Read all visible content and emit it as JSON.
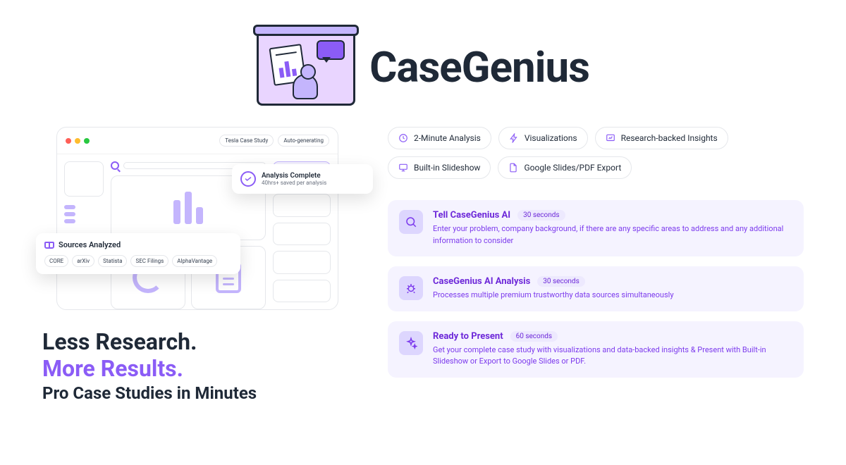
{
  "brand": {
    "name": "CaseGenius"
  },
  "app_preview": {
    "pills": [
      "Tesla Case Study",
      "Auto-generating"
    ],
    "sources_card": {
      "title": "Sources Analyzed",
      "chips": [
        "CORE",
        "arXiv",
        "Statista",
        "SEC Filings",
        "AlphaVantage"
      ]
    },
    "analysis_card": {
      "title": "Analysis Complete",
      "subtitle": "40hrs+ saved per analysis"
    }
  },
  "hero": {
    "line1": "Less Research.",
    "line2": "More Results.",
    "line3": "Pro Case Studies in Minutes"
  },
  "features": [
    {
      "icon": "clock",
      "label": "2-Minute Analysis"
    },
    {
      "icon": "bolt",
      "label": "Visualizations"
    },
    {
      "icon": "insight",
      "label": "Research-backed Insights"
    },
    {
      "icon": "slideshow",
      "label": "Built-in Slideshow"
    },
    {
      "icon": "export",
      "label": "Google Slides/PDF Export"
    }
  ],
  "steps": [
    {
      "icon": "search",
      "title": "Tell CaseGenius AI",
      "time": "30 seconds",
      "desc": "Enter your problem, company background, if there are any specific areas to address and any additional information to consider"
    },
    {
      "icon": "bug",
      "title": "CaseGenius AI Analysis",
      "time": "30 seconds",
      "desc": "Processes multiple premium trustworthy data sources simultaneously"
    },
    {
      "icon": "sparkle",
      "title": "Ready to Present",
      "time": "60 seconds",
      "desc": "Get your complete case study with visualizations and data-backed insights & Present with Built-in Slideshow or Export to Google Slides or PDF."
    }
  ]
}
